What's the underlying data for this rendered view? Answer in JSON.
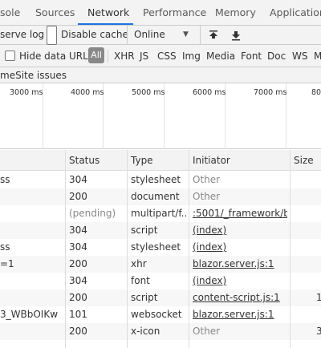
{
  "tabs": [
    {
      "label": "sole"
    },
    {
      "label": "Sources"
    },
    {
      "label": "Network"
    },
    {
      "label": "Performance"
    },
    {
      "label": "Memory"
    },
    {
      "label": "Application"
    }
  ],
  "toolbar1": {
    "preserve_log": "serve log",
    "disable_cache": "Disable cache",
    "throttling": "Online",
    "dropdown_arrow": "▼"
  },
  "toolbar2": {
    "hide_data_urls": "Hide data URLs",
    "all": "All",
    "types": [
      "XHR",
      "JS",
      "CSS",
      "Img",
      "Media",
      "Font",
      "Doc",
      "WS",
      "M"
    ]
  },
  "toolbar3": {
    "same_site": "meSite issues"
  },
  "timeline": {
    "labels": [
      "3000 ms",
      "4000 ms",
      "5000 ms",
      "6000 ms",
      "7000 ms",
      "80"
    ]
  },
  "table": {
    "headers": {
      "status": "Status",
      "type": "Type",
      "initiator": "Initiator",
      "size": "Size"
    },
    "rows": [
      {
        "name": "ss",
        "status": "304",
        "type": "stylesheet",
        "initiator": "Other",
        "size": ""
      },
      {
        "name": "",
        "status": "200",
        "type": "document",
        "initiator": "Other",
        "size": ""
      },
      {
        "name": "",
        "status": "(pending)",
        "type": "multipart/f...",
        "initiator": ":5001/_framework/b...",
        "size": ""
      },
      {
        "name": "",
        "status": "304",
        "type": "script",
        "initiator": "(index)",
        "size": ""
      },
      {
        "name": "ss",
        "status": "304",
        "type": "stylesheet",
        "initiator": "(index)",
        "size": ""
      },
      {
        "name": "=1",
        "status": "200",
        "type": "xhr",
        "initiator": "blazor.server.js:1",
        "size": ""
      },
      {
        "name": "",
        "status": "304",
        "type": "font",
        "initiator": "(index)",
        "size": ""
      },
      {
        "name": "",
        "status": "200",
        "type": "script",
        "initiator": "content-script.js:1",
        "size": "1"
      },
      {
        "name": "3_WBbOIKw",
        "status": "101",
        "type": "websocket",
        "initiator": "blazor.server.js:1",
        "size": ""
      },
      {
        "name": "",
        "status": "200",
        "type": "x-icon",
        "initiator": "Other",
        "size": "3"
      }
    ]
  }
}
